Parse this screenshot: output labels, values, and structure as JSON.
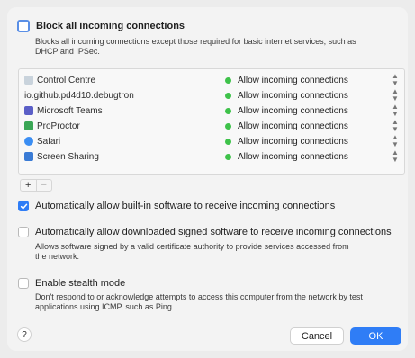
{
  "block_all": {
    "label": "Block all incoming connections",
    "checked": false,
    "description_line1": "Blocks all incoming connections except those required for basic internet services, such as",
    "description_line2": "DHCP and IPSec."
  },
  "apps": [
    {
      "name": "Control Centre",
      "icon": "control-centre-icon",
      "icon_color": "#c9d3dc",
      "status": "Allow incoming connections"
    },
    {
      "name": "io.github.pd4d10.debugtron",
      "icon": "",
      "icon_color": "",
      "status": "Allow incoming connections"
    },
    {
      "name": "Microsoft Teams",
      "icon": "microsoft-teams-icon",
      "icon_color": "#5b5fc7",
      "status": "Allow incoming connections"
    },
    {
      "name": "ProProctor",
      "icon": "proproctor-icon",
      "icon_color": "#3aa655",
      "status": "Allow incoming connections"
    },
    {
      "name": "Safari",
      "icon": "safari-icon",
      "icon_color": "#3b8ef3",
      "status": "Allow incoming connections"
    },
    {
      "name": "Screen Sharing",
      "icon": "screen-sharing-icon",
      "icon_color": "#3a7bd5",
      "status": "Allow incoming connections"
    }
  ],
  "status_color": "#3ec24a",
  "add_label": "+",
  "remove_label": "−",
  "auto_builtin": {
    "label": "Automatically allow built-in software to receive incoming connections",
    "checked": true
  },
  "auto_signed": {
    "label": "Automatically allow downloaded signed software to receive incoming connections",
    "checked": false,
    "description_line1": "Allows software signed by a valid certificate authority to provide services accessed from",
    "description_line2": "the network."
  },
  "stealth": {
    "label": "Enable stealth mode",
    "checked": false,
    "description_line1": "Don't respond to or acknowledge attempts to access this computer from the network by test",
    "description_line2": "applications using ICMP, such as Ping."
  },
  "help_label": "?",
  "cancel_label": "Cancel",
  "ok_label": "OK",
  "accent_color": "#2f7df6"
}
